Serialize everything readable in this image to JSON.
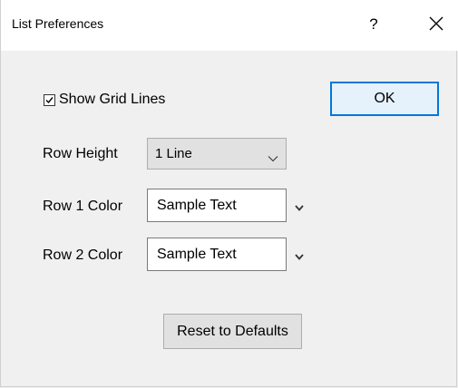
{
  "window": {
    "title": "List Preferences",
    "help_label": "?",
    "close_icon": "close-icon"
  },
  "options": {
    "show_grid_lines_label": "Show Grid Lines",
    "show_grid_lines_checked": true
  },
  "buttons": {
    "ok_label": "OK",
    "reset_label": "Reset to Defaults"
  },
  "row_height": {
    "label": "Row Height",
    "selected": "1 Line"
  },
  "row1_color": {
    "label": "Row 1 Color",
    "sample_text": "Sample Text"
  },
  "row2_color": {
    "label": "Row 2 Color",
    "sample_text": "Sample Text"
  },
  "colors": {
    "accent": "#0078d7",
    "dialog_bg": "#f0f0f0",
    "titlebar_bg": "#ffffff"
  }
}
